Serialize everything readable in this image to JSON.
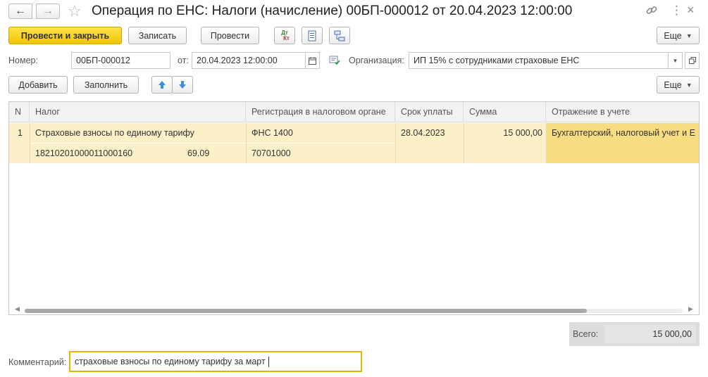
{
  "window": {
    "title": "Операция по ЕНС: Налоги (начисление) 00БП-000012 от 20.04.2023 12:00:00",
    "icons": {
      "back": "arrow-left-icon",
      "forward": "arrow-right-icon",
      "favorite": "star-icon",
      "link": "link-icon",
      "more": "more-vertical-icon",
      "close": "close-icon"
    }
  },
  "toolbar": {
    "post_and_close": "Провести и закрыть",
    "save": "Записать",
    "post": "Провести",
    "dt_kt_top": "Дт",
    "dt_kt_bottom": "Кт",
    "more": "Еще"
  },
  "header": {
    "number_label": "Номер:",
    "number_value": "00БП-000012",
    "date_label": "от:",
    "date_value": "20.04.2023 12:00:00",
    "org_label": "Организация:",
    "org_value": "ИП 15% с сотрудниками страховые ЕНС"
  },
  "table_toolbar": {
    "add": "Добавить",
    "fill": "Заполнить",
    "more": "Еще"
  },
  "table": {
    "columns": [
      "N",
      "Налог",
      "Регистрация в налоговом органе",
      "Срок уплаты",
      "Сумма",
      "Отражение в учете"
    ],
    "rows": [
      {
        "n": "1",
        "tax": "Страховые взносы по единому тарифу",
        "kbk": "18210201000011000160",
        "account": "69.09",
        "registration": "ФНС 1400",
        "oktmo": "70701000",
        "due_date": "28.04.2023",
        "amount": "15 000,00",
        "accounting": "Бухгалтерский, налоговый учет и Е"
      }
    ]
  },
  "totals": {
    "label": "Всего:",
    "value": "15 000,00"
  },
  "comment": {
    "label": "Комментарий:",
    "value": "страховые взносы по единому тарифу за март"
  },
  "colors": {
    "primary_button": "#f5cd0f",
    "selected_row": "#fbf0c8",
    "accounting_cell": "#f7dc82",
    "focus_border": "#e8b400"
  }
}
